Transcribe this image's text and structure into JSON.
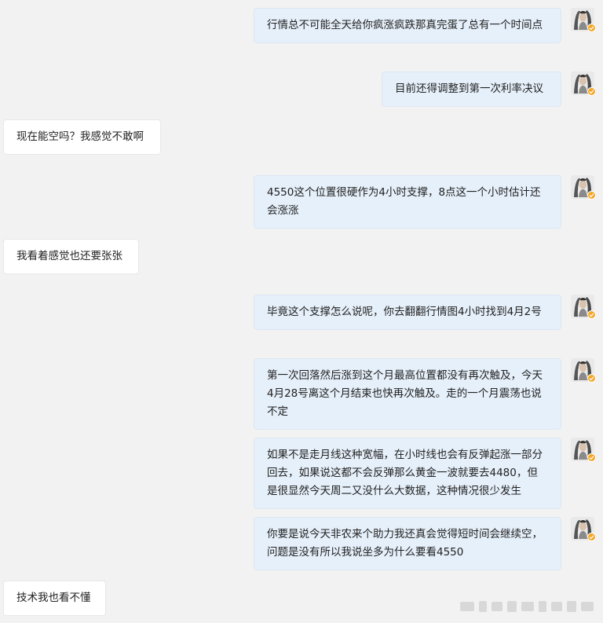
{
  "conversation": {
    "messages": [
      {
        "side": "me",
        "text": "行情总不可能全天给你疯涨疯跌那真完蛋了总有一个时间点"
      },
      {
        "side": "me",
        "text": "目前还得调整到第一次利率决议"
      },
      {
        "side": "other",
        "text": "现在能空吗？我感觉不敢啊"
      },
      {
        "side": "me",
        "text": "4550这个位置很硬作为4小时支撑，8点这一个小时估计还会涨涨"
      },
      {
        "side": "other",
        "text": "我看着感觉也还要张张"
      },
      {
        "side": "me",
        "text": "毕竟这个支撑怎么说呢，你去翻翻行情图4小时找到4月2号"
      },
      {
        "side": "me",
        "text": "第一次回落然后涨到这个月最高位置都没有再次触及，今天4月28号离这个月结束也快再次触及。走的一个月震荡也说不定"
      },
      {
        "side": "me",
        "text": "如果不是走月线这种宽幅，在小时线也会有反弹起涨一部分回去，如果说这都不会反弹那么黄金一波就要去4480，但是很显然今天周二又没什么大数据，这种情况很少发生"
      },
      {
        "side": "me",
        "text": "你要是说今天非农来个助力我还真会觉得短时间会继续空，问题是没有所以我说坐多为什么要看4550"
      },
      {
        "side": "other",
        "text": "技术我也看不懂"
      }
    ]
  },
  "colors": {
    "background": "#f2f2f2",
    "my_bubble": "#e6f0fa",
    "other_bubble": "#ffffff",
    "verified_badge": "#f5a623"
  },
  "icons": {
    "avatar": "user-avatar-icon",
    "badge": "verified-badge-icon"
  }
}
